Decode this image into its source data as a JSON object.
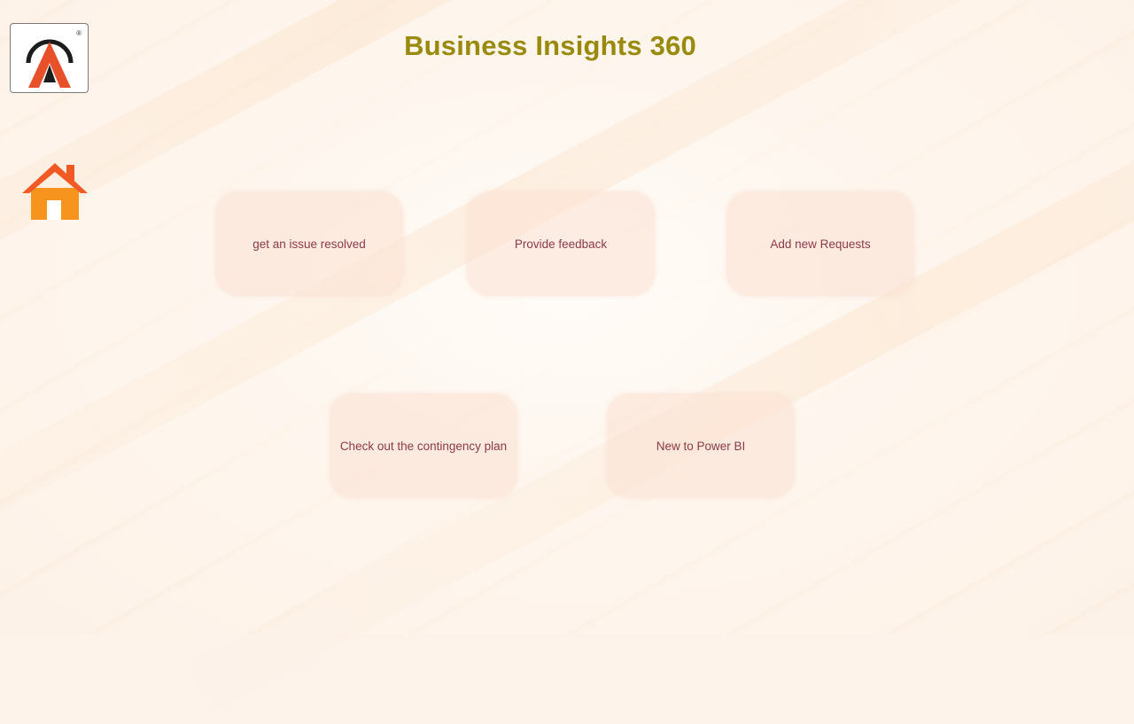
{
  "header": {
    "title": "Business Insights 360"
  },
  "logo": {
    "registered_mark": "®"
  },
  "nav": {
    "home_icon": "home-icon"
  },
  "cards": [
    {
      "label": "get an issue resolved"
    },
    {
      "label": "Provide feedback"
    },
    {
      "label": "Add new Requests"
    },
    {
      "label": "Check out the contingency plan"
    },
    {
      "label": "New to Power BI"
    }
  ],
  "colors": {
    "title": "#9a8a0c",
    "card_text": "#8e3a46",
    "card_bg": "#fbe0d2",
    "home_roof": "#f15a24",
    "home_body": "#f7941d"
  }
}
